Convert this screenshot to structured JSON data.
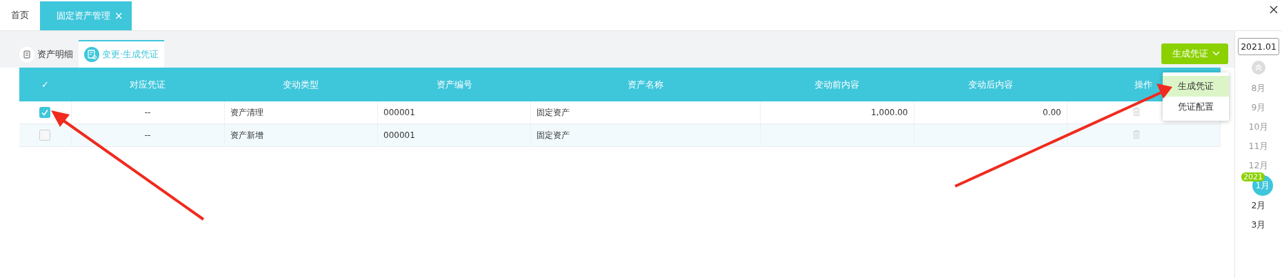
{
  "tabs": [
    {
      "label": "首页",
      "selected": false,
      "closable": false
    },
    {
      "label": "固定资产管理",
      "selected": true,
      "closable": true
    }
  ],
  "close_glyph": "×",
  "subtabs": [
    {
      "label": "资产明细",
      "selected": false
    },
    {
      "label": "变更·生成凭证",
      "selected": true
    }
  ],
  "generate_button": {
    "label": "生成凭证"
  },
  "dropdown": [
    {
      "label": "生成凭证",
      "selected": true
    },
    {
      "label": "凭证配置",
      "selected": false
    }
  ],
  "table": {
    "select_all": {
      "glyph": "✓",
      "checked": false
    },
    "columns": [
      "对应凭证",
      "变动类型",
      "资产编号",
      "资产名称",
      "变动前内容",
      "变动后内容",
      "操作"
    ],
    "rows": [
      {
        "checked": true,
        "cells": [
          "--",
          "资产清理",
          "000001",
          "固定资产",
          "1,000.00",
          "0.00"
        ]
      },
      {
        "checked": false,
        "cells": [
          "--",
          "资产新增",
          "000001",
          "固定资产",
          "",
          ""
        ]
      }
    ]
  },
  "timeline": {
    "period": "2021.01",
    "year_badge": "2021",
    "months": [
      {
        "label": "8月",
        "selected": false,
        "dimmed": true
      },
      {
        "label": "9月",
        "selected": false,
        "dimmed": true
      },
      {
        "label": "10月",
        "selected": false,
        "dimmed": true
      },
      {
        "label": "11月",
        "selected": false,
        "dimmed": true
      },
      {
        "label": "12月",
        "selected": false,
        "dimmed": true
      },
      {
        "label": "1月",
        "selected": true,
        "dimmed": false
      },
      {
        "label": "2月",
        "selected": false,
        "dimmed": false
      },
      {
        "label": "3月",
        "selected": false,
        "dimmed": false
      }
    ]
  }
}
